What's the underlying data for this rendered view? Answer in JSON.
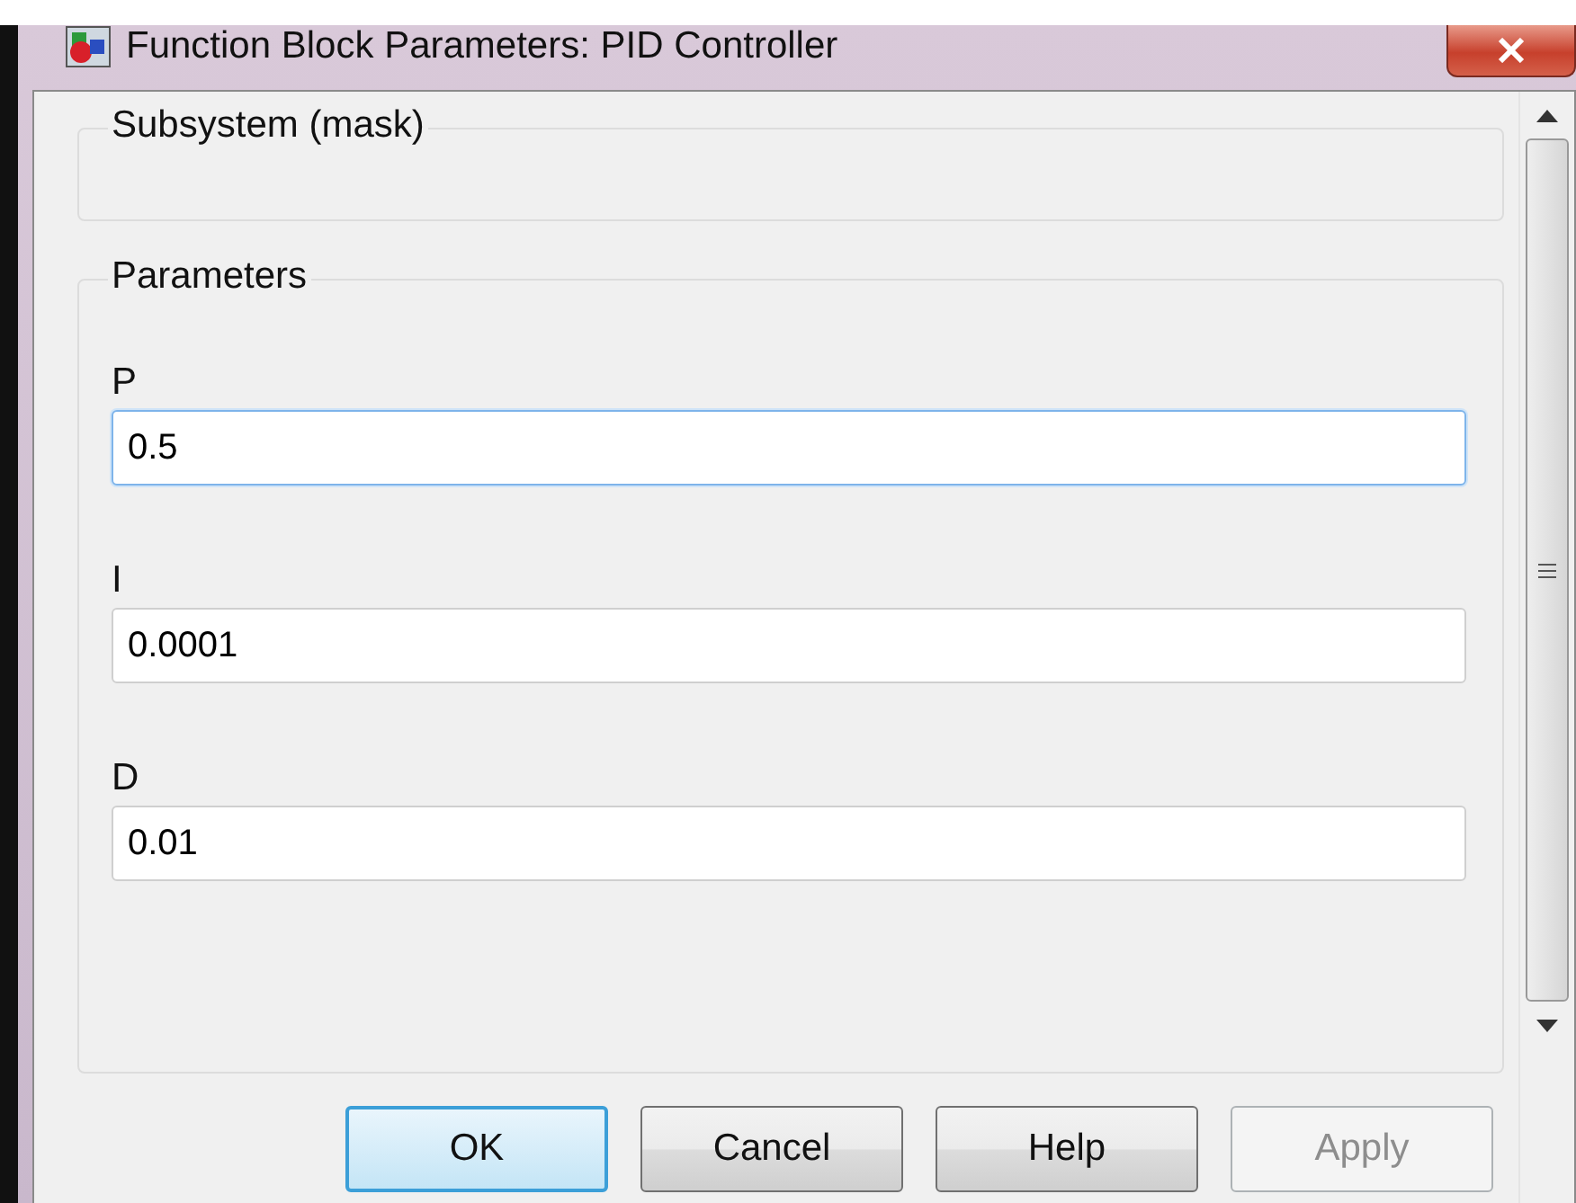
{
  "window": {
    "title": "Function Block Parameters: PID Controller"
  },
  "subsystem": {
    "heading": "Subsystem (mask)"
  },
  "parameters": {
    "heading": "Parameters",
    "fields": [
      {
        "label": "P",
        "value": "0.5",
        "focused": true
      },
      {
        "label": "I",
        "value": "0.0001",
        "focused": false
      },
      {
        "label": "D",
        "value": "0.01",
        "focused": false
      }
    ]
  },
  "buttons": [
    {
      "label": "OK",
      "default": true,
      "disabled": false
    },
    {
      "label": "Cancel",
      "default": false,
      "disabled": false
    },
    {
      "label": "Help",
      "default": false,
      "disabled": false
    },
    {
      "label": "Apply",
      "default": false,
      "disabled": true
    }
  ]
}
